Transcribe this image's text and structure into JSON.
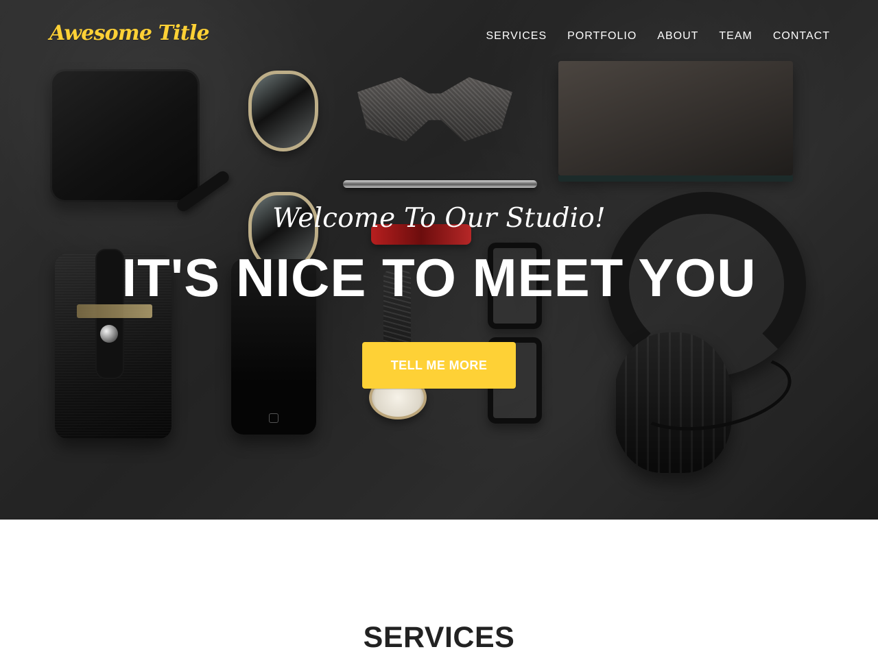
{
  "colors": {
    "accent": "#fed136",
    "hero_overlay": "#2f2f2f",
    "white": "#ffffff",
    "heading_dark": "#222222"
  },
  "brand": {
    "name": "Awesome Title"
  },
  "navigation": {
    "items": [
      {
        "label": "SERVICES"
      },
      {
        "label": "PORTFOLIO"
      },
      {
        "label": "ABOUT"
      },
      {
        "label": "TEAM"
      },
      {
        "label": "CONTACT"
      }
    ]
  },
  "hero": {
    "subheading": "Welcome To Our Studio!",
    "heading": "IT'S NICE TO MEET YOU",
    "button_label": "TELL ME MORE"
  },
  "services": {
    "title": "SERVICES"
  },
  "images": {
    "hero_background": "flat-lay-accessories-photo"
  }
}
